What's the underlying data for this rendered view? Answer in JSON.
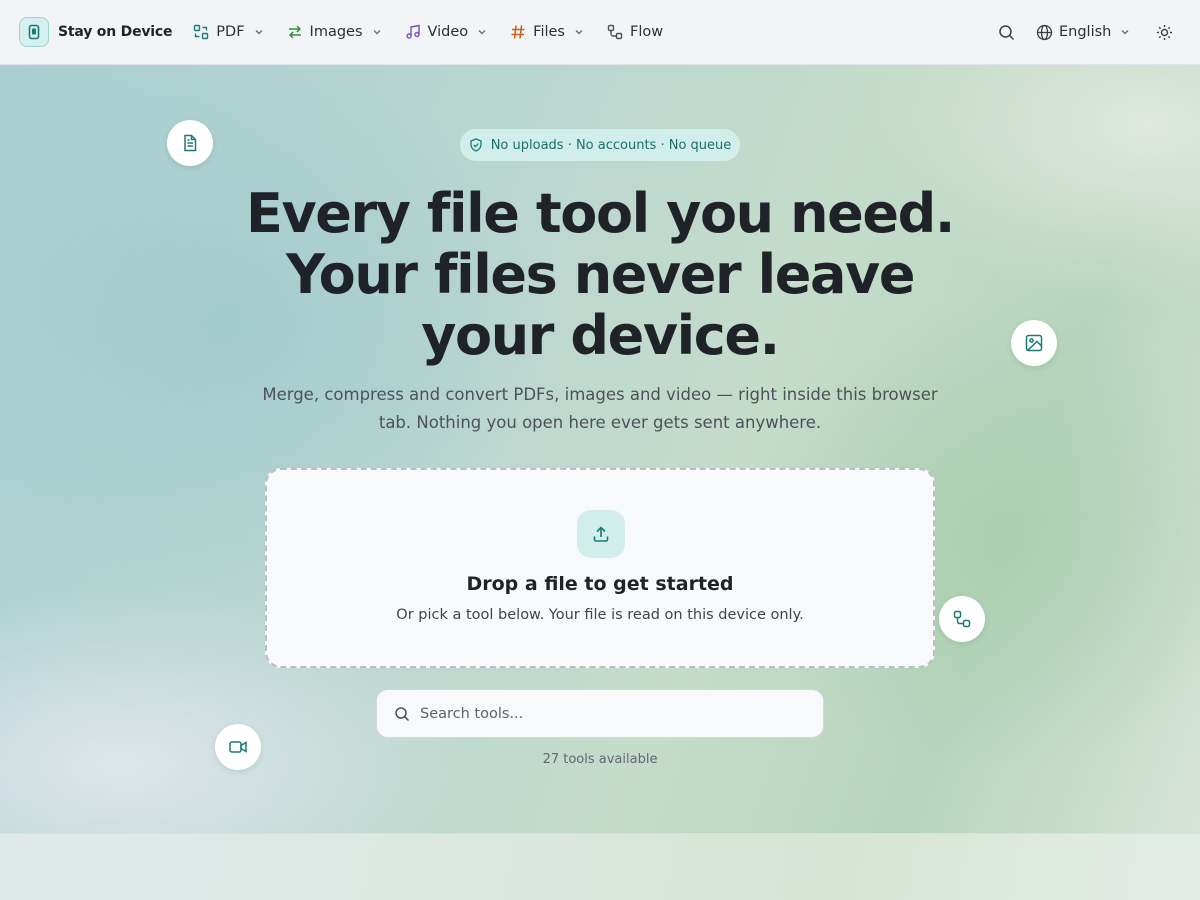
{
  "nav": {
    "brand": "Stay on Device",
    "items": [
      {
        "label": "PDF",
        "icon": "pdf-convert-icon",
        "has_dropdown": true
      },
      {
        "label": "Images",
        "icon": "swap-arrows-icon",
        "has_dropdown": true
      },
      {
        "label": "Video",
        "icon": "music-note-icon",
        "has_dropdown": true
      },
      {
        "label": "Files",
        "icon": "hash-icon",
        "has_dropdown": true
      },
      {
        "label": "Flow",
        "icon": "flow-nodes-icon",
        "has_dropdown": false
      }
    ],
    "language": "English"
  },
  "hero": {
    "badge": "No uploads · No accounts · No queue",
    "headline": "Every file tool you need. Your files never leave your device.",
    "subtext": "Merge, compress and convert PDFs, images and video — right inside this browser tab. Nothing you open here ever gets sent anywhere.",
    "dropzone": {
      "title": "Drop a file to get started",
      "subtitle": "Or pick a tool below. Your file is read on this device only."
    },
    "search_placeholder": "Search tools...",
    "tools_count": "27 tools available"
  },
  "colors": {
    "accent": "#1b7a74",
    "badge_bg": "#d2eeeb",
    "pdf_icon": "#1b7a74",
    "images_icon": "#2f8f3a",
    "video_icon": "#7a4fbf",
    "files_icon": "#c2621d"
  }
}
